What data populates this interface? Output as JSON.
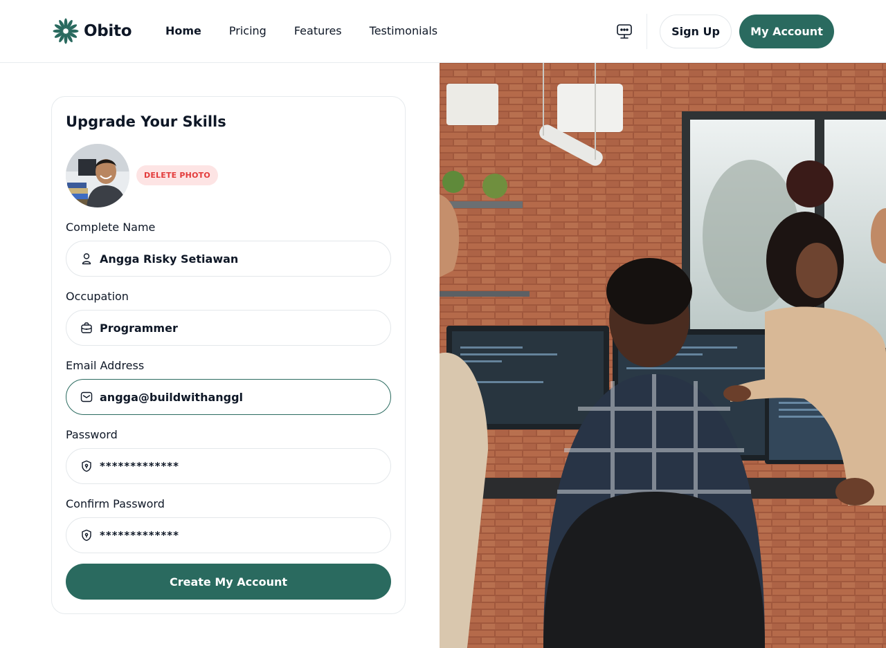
{
  "brand": {
    "name": "Obito",
    "color": "#2a6a5f"
  },
  "nav": {
    "items": [
      {
        "label": "Home",
        "active": true
      },
      {
        "label": "Pricing",
        "active": false
      },
      {
        "label": "Features",
        "active": false
      },
      {
        "label": "Testimonials",
        "active": false
      }
    ]
  },
  "header": {
    "chat_icon": "chat-monitor-icon",
    "signup_label": "Sign Up",
    "account_label": "My Account"
  },
  "form": {
    "title": "Upgrade Your Skills",
    "delete_photo_label": "DELETE PHOTO",
    "fields": {
      "name": {
        "label": "Complete Name",
        "value": "Angga Risky Setiawan",
        "icon": "user-icon"
      },
      "occupation": {
        "label": "Occupation",
        "value": "Programmer",
        "icon": "briefcase-icon"
      },
      "email": {
        "label": "Email Address",
        "value": "angga@buildwithanggl",
        "icon": "mail-icon"
      },
      "password": {
        "label": "Password",
        "value": "*************",
        "icon": "shield-lock-icon"
      },
      "confirm_password": {
        "label": "Confirm Password",
        "value": "*************",
        "icon": "shield-lock-icon"
      }
    },
    "submit_label": "Create My Account"
  },
  "colors": {
    "accent": "#2a6a5f",
    "danger": "#e33b3b",
    "danger_bg": "#fde4e4",
    "border": "#e3e7ea"
  }
}
